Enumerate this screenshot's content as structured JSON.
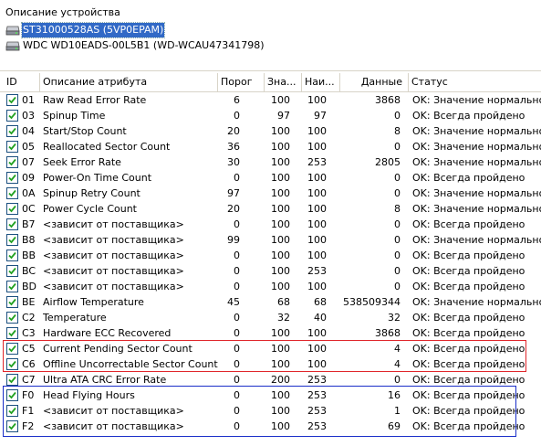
{
  "device_section": {
    "label": "Описание устройства",
    "devices": [
      {
        "name": "ST31000528AS (5VP0EPAM)",
        "selected": true
      },
      {
        "name": "WDC WD10EADS-00L5B1 (WD-WCAU47341798)",
        "selected": false
      }
    ]
  },
  "columns": [
    "ID",
    "Описание атрибута",
    "Порог",
    "Зна...",
    "Наи...",
    "Данные",
    "Статус"
  ],
  "rows": [
    {
      "id": "01",
      "name": "Raw Read Error Rate",
      "threshold": "6",
      "value": "100",
      "worst": "100",
      "data": "3868",
      "status": "OK: Значение нормальное"
    },
    {
      "id": "03",
      "name": "Spinup Time",
      "threshold": "0",
      "value": "97",
      "worst": "97",
      "data": "0",
      "status": "OK: Всегда пройдено"
    },
    {
      "id": "04",
      "name": "Start/Stop Count",
      "threshold": "20",
      "value": "100",
      "worst": "100",
      "data": "8",
      "status": "OK: Значение нормальное"
    },
    {
      "id": "05",
      "name": "Reallocated Sector Count",
      "threshold": "36",
      "value": "100",
      "worst": "100",
      "data": "0",
      "status": "OK: Значение нормальное"
    },
    {
      "id": "07",
      "name": "Seek Error Rate",
      "threshold": "30",
      "value": "100",
      "worst": "253",
      "data": "2805",
      "status": "OK: Значение нормальное"
    },
    {
      "id": "09",
      "name": "Power-On Time Count",
      "threshold": "0",
      "value": "100",
      "worst": "100",
      "data": "0",
      "status": "OK: Всегда пройдено"
    },
    {
      "id": "0A",
      "name": "Spinup Retry Count",
      "threshold": "97",
      "value": "100",
      "worst": "100",
      "data": "0",
      "status": "OK: Значение нормальное"
    },
    {
      "id": "0C",
      "name": "Power Cycle Count",
      "threshold": "20",
      "value": "100",
      "worst": "100",
      "data": "8",
      "status": "OK: Значение нормальное"
    },
    {
      "id": "B7",
      "name": "<зависит от поставщика>",
      "threshold": "0",
      "value": "100",
      "worst": "100",
      "data": "0",
      "status": "OK: Всегда пройдено"
    },
    {
      "id": "B8",
      "name": "<зависит от поставщика>",
      "threshold": "99",
      "value": "100",
      "worst": "100",
      "data": "0",
      "status": "OK: Значение нормальное"
    },
    {
      "id": "BB",
      "name": "<зависит от поставщика>",
      "threshold": "0",
      "value": "100",
      "worst": "100",
      "data": "0",
      "status": "OK: Всегда пройдено"
    },
    {
      "id": "BC",
      "name": "<зависит от поставщика>",
      "threshold": "0",
      "value": "100",
      "worst": "253",
      "data": "0",
      "status": "OK: Всегда пройдено"
    },
    {
      "id": "BD",
      "name": "<зависит от поставщика>",
      "threshold": "0",
      "value": "100",
      "worst": "100",
      "data": "0",
      "status": "OK: Всегда пройдено"
    },
    {
      "id": "BE",
      "name": "Airflow Temperature",
      "threshold": "45",
      "value": "68",
      "worst": "68",
      "data": "538509344",
      "status": "OK: Значение нормальное"
    },
    {
      "id": "C2",
      "name": "Temperature",
      "threshold": "0",
      "value": "32",
      "worst": "40",
      "data": "32",
      "status": "OK: Всегда пройдено"
    },
    {
      "id": "C3",
      "name": "Hardware ECC Recovered",
      "threshold": "0",
      "value": "100",
      "worst": "100",
      "data": "3868",
      "status": "OK: Всегда пройдено"
    },
    {
      "id": "C5",
      "name": "Current Pending Sector Count",
      "threshold": "0",
      "value": "100",
      "worst": "100",
      "data": "4",
      "status": "OK: Всегда пройдено"
    },
    {
      "id": "C6",
      "name": "Offline Uncorrectable Sector Count",
      "threshold": "0",
      "value": "100",
      "worst": "100",
      "data": "4",
      "status": "OK: Всегда пройдено"
    },
    {
      "id": "C7",
      "name": "Ultra ATA CRC Error Rate",
      "threshold": "0",
      "value": "200",
      "worst": "253",
      "data": "0",
      "status": "OK: Всегда пройдено"
    },
    {
      "id": "F0",
      "name": "Head Flying Hours",
      "threshold": "0",
      "value": "100",
      "worst": "253",
      "data": "16",
      "status": "OK: Всегда пройдено"
    },
    {
      "id": "F1",
      "name": "<зависит от поставщика>",
      "threshold": "0",
      "value": "100",
      "worst": "253",
      "data": "1",
      "status": "OK: Всегда пройдено"
    },
    {
      "id": "F2",
      "name": "<зависит от поставщика>",
      "threshold": "0",
      "value": "100",
      "worst": "253",
      "data": "69",
      "status": "OK: Всегда пройдено"
    }
  ],
  "highlights": [
    {
      "rows": [
        "C5",
        "C6"
      ],
      "color": "#e0262b"
    },
    {
      "rows": [
        "F0",
        "F1",
        "F2"
      ],
      "color": "#1a2fc9"
    }
  ]
}
